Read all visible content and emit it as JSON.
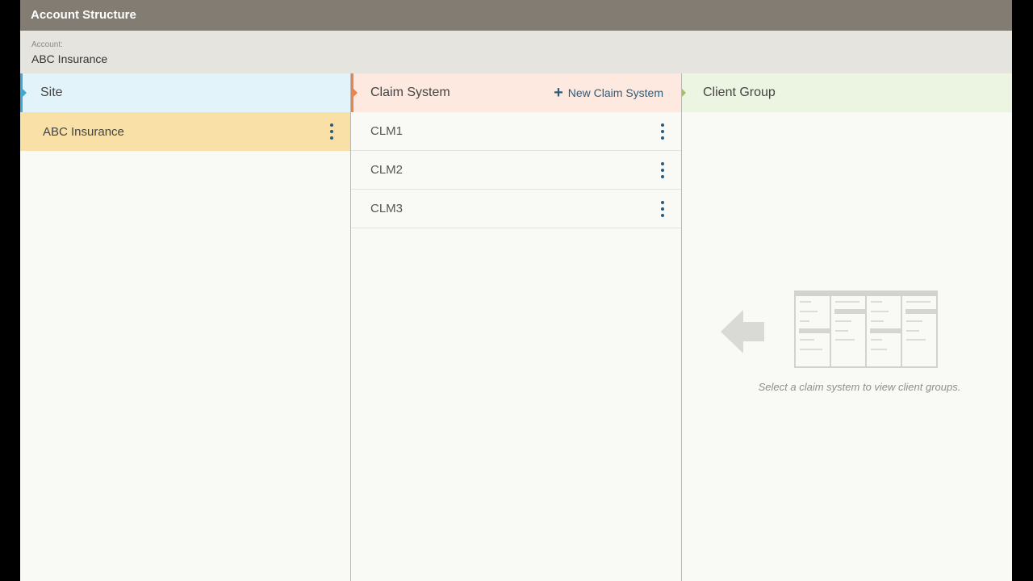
{
  "app": {
    "title": "Account Structure"
  },
  "account": {
    "label": "Account:",
    "value": "ABC Insurance"
  },
  "columns": {
    "site": {
      "header": "Site",
      "items": [
        {
          "label": "ABC Insurance",
          "selected": true
        }
      ]
    },
    "claim_system": {
      "header": "Claim System",
      "new_button_label": "New Claim System",
      "items": [
        {
          "label": "CLM1"
        },
        {
          "label": "CLM2"
        },
        {
          "label": "CLM3"
        }
      ]
    },
    "client_group": {
      "header": "Client Group",
      "empty_message": "Select a claim system to view client groups."
    }
  },
  "colors": {
    "titlebar": "#827c72",
    "site_accent": "#3fa9d4",
    "claim_accent": "#e9844e",
    "client_accent": "#9ec45a",
    "selected_row": "#f8e0a6",
    "action": "#2b5c7e"
  },
  "icons": {
    "row_menu": "kebab-menu-icon",
    "add": "plus-icon",
    "empty_arrow": "arrow-left-icon"
  }
}
